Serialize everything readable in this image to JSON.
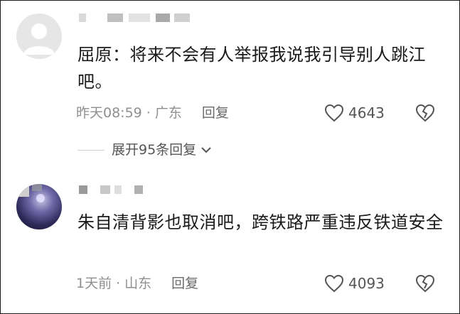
{
  "comments": [
    {
      "text": "屈原：将来不会有人举报我说我引导别人跳江吧。",
      "time": "昨天08:59",
      "location": "广东",
      "reply_label": "回复",
      "likes": "4643",
      "expand_label": "展开95条回复"
    },
    {
      "text": "朱自清背影也取消吧，跨铁路严重违反铁道安全",
      "time": "1天前",
      "location": "山东",
      "reply_label": "回复",
      "likes": "4093"
    }
  ],
  "separator": "·",
  "icons": {
    "like": "heart-outline-icon",
    "dislike": "broken-heart-icon",
    "expand": "chevron-down-icon"
  },
  "colors": {
    "text": "#1a1a1a",
    "meta": "#8f8f8f",
    "icon": "#555555"
  }
}
